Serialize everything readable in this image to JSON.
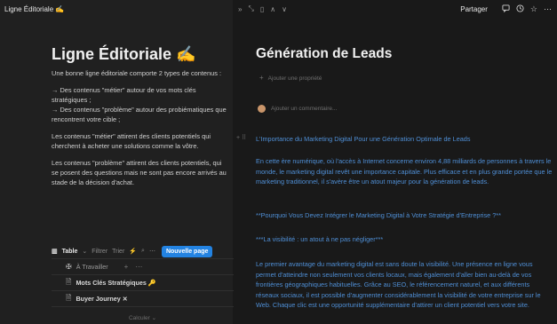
{
  "topbar": {
    "page_name": "Ligne Éditoriale ✍️",
    "controls": [
      "»",
      "⤡",
      "▯",
      "∧",
      "∨"
    ],
    "share_label": "Partager",
    "icons": [
      "comment-icon",
      "history-icon",
      "star-icon",
      "more-icon"
    ]
  },
  "left": {
    "title": "Ligne Éditoriale ✍️",
    "intro": "Une bonne ligne éditoriale comporte 2 types de contenus :",
    "bullet1": "→ Des contenus \"métier\" autour de vos mots clés stratégiques ;",
    "bullet2": "→ Des contenus \"problème\" autour des probiématiques que rencontrent votre cible ;",
    "metier": "Les contenus \"métier\" attirent des clients potentiels qui cherchent à acheter une solutions comme la vôtre.",
    "probleme": "Les contenus \"problème\" attirent des clients potentiels, qui se posent des questions mais ne sont pas encore arrivés au stade de la décision d'achat."
  },
  "database": {
    "view_label": "Table",
    "filter_label": "Filtrer",
    "sort_label": "Trier",
    "new_label": "Nouvelle page",
    "group_label": "À Travailler",
    "rows": [
      "Mots Clés Stratégiques 🔑",
      "Buyer Journey ✕"
    ],
    "calc_label": "Calculer ⌄"
  },
  "main": {
    "title": "Génération de Leads",
    "add_property": "Ajouter une propriété",
    "add_comment": "Ajouter un commentaire...",
    "p1": "L'Importance du Marketing Digital Pour une Génération Optimale de Leads",
    "p2": "En cette ère numérique, où l'accès à Internet concerne environ 4,88 milliards de personnes à travers le monde, le marketing digital revêt une importance capitale. Plus efficace et en plus grande portée que le marketing traditionnel, il s'avère être un atout majeur pour la génération de leads.",
    "p3": "**Pourquoi Vous Devez Intégrer le Marketing Digital à Votre Stratégie d'Entreprise ?**",
    "p4": "***La visibilité : un atout à ne pas négliger***",
    "p5": "Le premier avantage du marketing digital est sans doute la visibilité. Une présence en ligne vous permet d'atteindre non seulement vos clients locaux, mais également d'aller bien au-delà de vos frontières géographiques habituelles. Grâce au SEO, le référencement naturel, et aux différents réseaux sociaux, il est possible d'augmenter considérablement la visibilité de votre entreprise sur le Web. Chaque clic est une opportunité supplémentaire d'attirer un client potentiel vers votre site."
  },
  "colors": {
    "accent": "#2383e2",
    "link_text": "#4f8fd6",
    "bg": "#191919",
    "sidebar_bg": "#202020"
  }
}
